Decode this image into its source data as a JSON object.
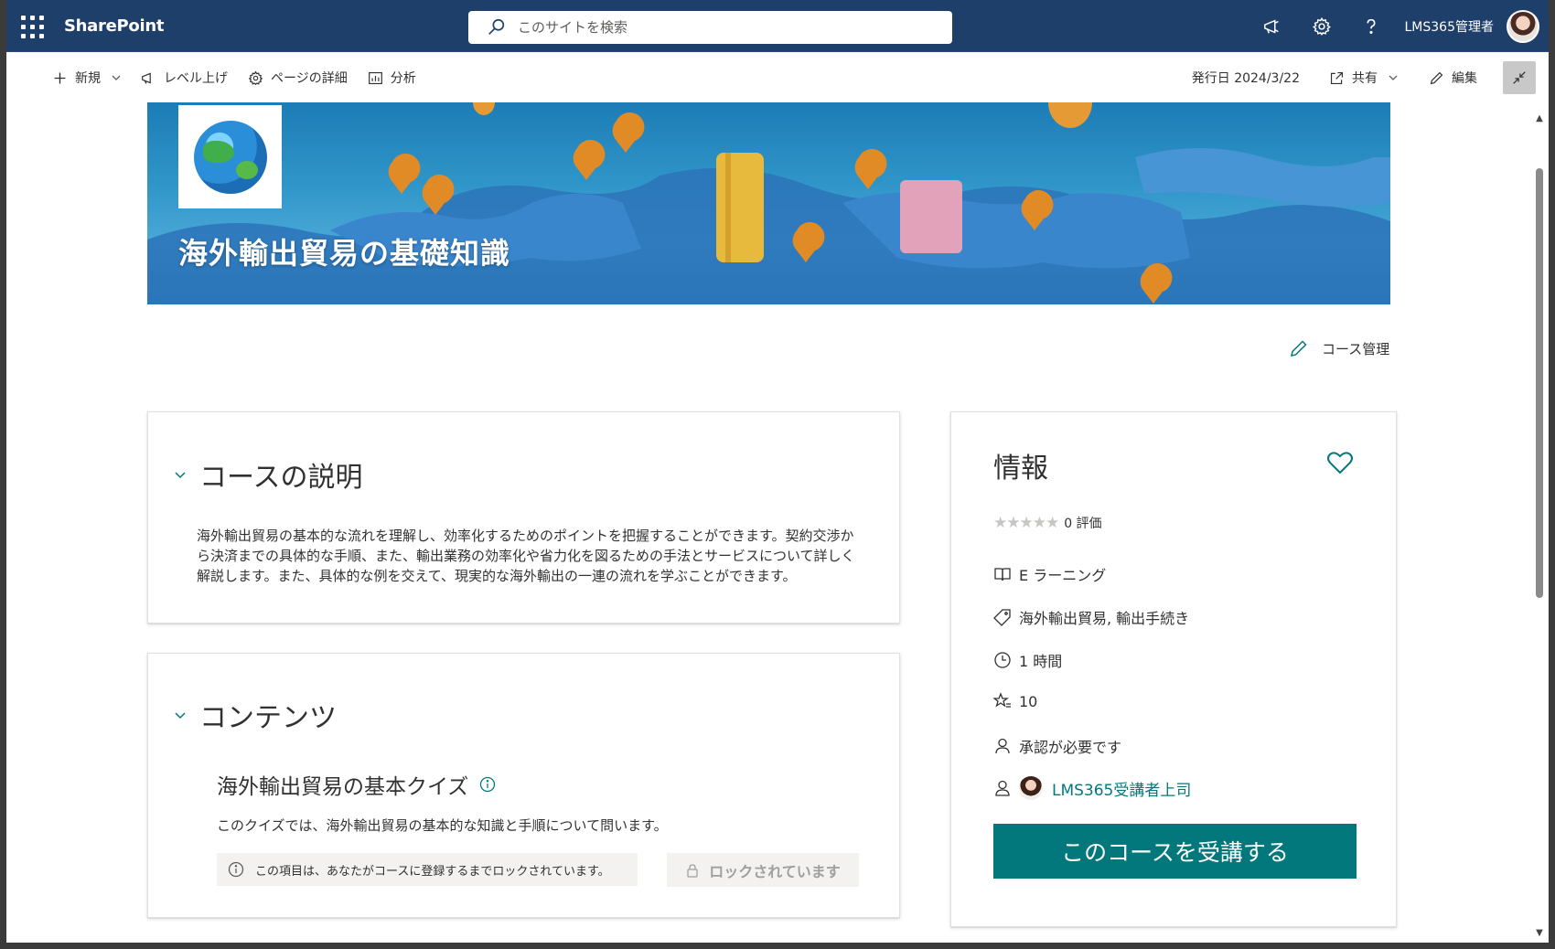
{
  "suitebar": {
    "brand": "SharePoint",
    "search_placeholder": "このサイトを検索",
    "user_name": "LMS365管理者"
  },
  "commandbar": {
    "new_label": "新規",
    "promote_label": "レベル上げ",
    "page_details_label": "ページの詳細",
    "analytics_label": "分析",
    "published": "発行日 2024/3/22",
    "share_label": "共有",
    "edit_label": "編集"
  },
  "hero": {
    "title": "海外輸出貿易の基礎知識"
  },
  "course_manage_label": "コース管理",
  "description": {
    "heading": "コースの説明",
    "text": "海外輸出貿易の基本的な流れを理解し、効率化するためのポイントを把握することができます。契約交渉から決済までの具体的な手順、また、輸出業務の効率化や省力化を図るための手法とサービスについて詳しく解説します。また、具体的な例を交えて、現実的な海外輸出の一連の流れを学ぶことができます。"
  },
  "contents": {
    "heading": "コンテンツ",
    "quiz_title": "海外輸出貿易の基本クイズ",
    "quiz_desc": "このクイズでは、海外輸出貿易の基本的な知識と手順について問います。",
    "lock_note": "この項目は、あなたがコースに登録するまでロックされています。",
    "locked_button": "ロックされています"
  },
  "info": {
    "heading": "情報",
    "stars": "★★★★★",
    "rating_count": "0 評価",
    "type": "E ラーニング",
    "tags": "海外輸出貿易, 輸出手続き",
    "duration": "1 時間",
    "points": "10",
    "approval": "承認が必要です",
    "manager": "LMS365受講者上司",
    "enroll_button": "このコースを受講する"
  },
  "colors": {
    "suitebar": "#1f3f6b",
    "accent": "#03787c"
  }
}
